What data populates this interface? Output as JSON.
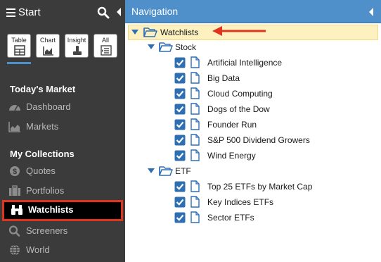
{
  "sidebar": {
    "title": "Start",
    "tiles": [
      {
        "label": "Table",
        "icon": "table-icon"
      },
      {
        "label": "Chart",
        "icon": "chart-icon"
      },
      {
        "label": "Insight",
        "icon": "insight-icon"
      },
      {
        "label": "All",
        "icon": "list-icon"
      }
    ],
    "sections": [
      {
        "title": "Today's Market",
        "items": [
          {
            "label": "Dashboard",
            "icon": "dashboard-icon"
          },
          {
            "label": "Markets",
            "icon": "area-chart-icon"
          }
        ]
      },
      {
        "title": "My Collections",
        "items": [
          {
            "label": "Quotes",
            "icon": "dollar-icon"
          },
          {
            "label": "Portfolios",
            "icon": "briefcase-icon"
          },
          {
            "label": "Watchlists",
            "icon": "binoculars-icon",
            "active": true
          },
          {
            "label": "Screeners",
            "icon": "search-icon"
          },
          {
            "label": "World",
            "icon": "globe-icon"
          }
        ]
      }
    ]
  },
  "panel": {
    "title": "Navigation",
    "tree": {
      "root": "Watchlists",
      "groups": [
        {
          "label": "Stock",
          "items": [
            "Artificial Intelligence",
            "Big Data",
            "Cloud Computing",
            "Dogs of the Dow",
            "Founder Run",
            "S&P 500 Dividend Growers",
            "Wind Energy"
          ]
        },
        {
          "label": "ETF",
          "items": [
            "Top 25 ETFs by Market Cap",
            "Key Indices ETFs",
            "Sector ETFs"
          ]
        }
      ]
    }
  },
  "colors": {
    "sidebar_bg": "#3b3b3b",
    "panel_header": "#4f8fca",
    "accent_blue": "#2e6fb4",
    "highlight_row": "#fdf1bf",
    "annotation_red": "#e0341f"
  }
}
